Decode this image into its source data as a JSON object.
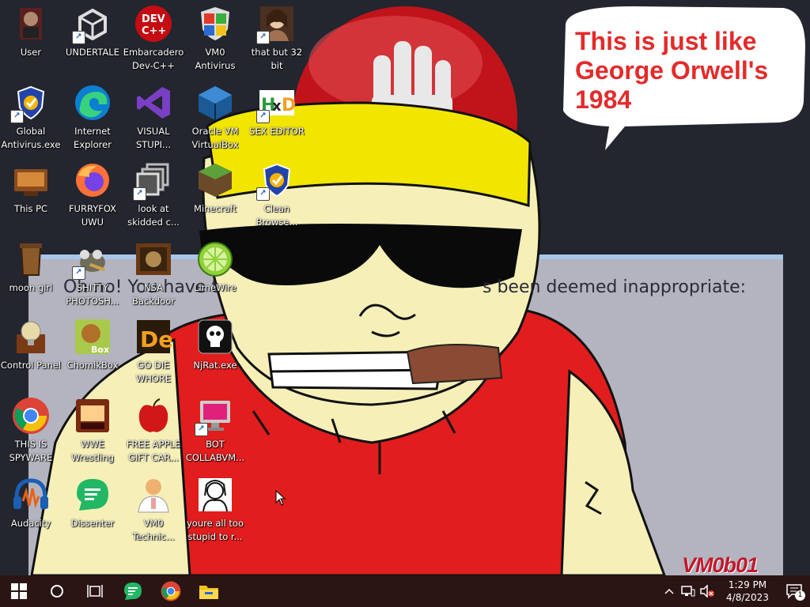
{
  "desktop": {
    "icons": [
      {
        "label": "User",
        "icon": "user-folder-icon"
      },
      {
        "label": "UNDERTALE",
        "icon": "unity-icon"
      },
      {
        "label": "Embarcadero Dev-C++",
        "icon": "devcpp-icon"
      },
      {
        "label": "VM0 Antivirus",
        "icon": "windows-shield-icon"
      },
      {
        "label": "that but 32 bit",
        "icon": "portrait-icon"
      },
      {
        "label": "Global Antivirus.exe",
        "icon": "shield-check-icon"
      },
      {
        "label": "Internet Explorer",
        "icon": "edge-icon"
      },
      {
        "label": "VISUAL STUPI...",
        "icon": "visual-studio-icon"
      },
      {
        "label": "Oracle VM VirtualBox",
        "icon": "virtualbox-icon"
      },
      {
        "label": "SEX EDITOR",
        "icon": "hxd-icon"
      },
      {
        "label": "This PC",
        "icon": "computer-icon"
      },
      {
        "label": "FURRYFOX UWU",
        "icon": "firefox-icon"
      },
      {
        "label": "look at skidded c...",
        "icon": "windows-stack-icon"
      },
      {
        "label": "Minecraft",
        "icon": "minecraft-icon"
      },
      {
        "label": "Clean Browse...",
        "icon": "shield-check-icon"
      },
      {
        "label": "moon girl",
        "icon": "bin-icon"
      },
      {
        "label": "SHITTY PHOTOSH...",
        "icon": "gimp-icon"
      },
      {
        "label": "NSA Backdoor",
        "icon": "picture-frame-icon"
      },
      {
        "label": "LimeWire",
        "icon": "limewire-icon"
      },
      {
        "label": "Control Panel",
        "icon": "lightbulb-icon"
      },
      {
        "label": "ChomikBox",
        "icon": "hamster-icon"
      },
      {
        "label": "GO DIE WHORE",
        "icon": "de-icon"
      },
      {
        "label": "NjRat.exe",
        "icon": "skull-icon"
      },
      {
        "label": "THIS IS SPYWARE",
        "icon": "chrome-icon"
      },
      {
        "label": "WWE Wrestling",
        "icon": "console-icon"
      },
      {
        "label": "FREE APPLE GIFT CAR...",
        "icon": "apple-icon"
      },
      {
        "label": "BOT COLLABVM...",
        "icon": "monitor-icon"
      },
      {
        "label": "Audacity",
        "icon": "audacity-icon"
      },
      {
        "label": "Dissenter",
        "icon": "chat-icon"
      },
      {
        "label": "VM0 Technic...",
        "icon": "doctor-icon"
      },
      {
        "label": "youre all too stupid to r...",
        "icon": "sketch-portrait-icon"
      }
    ]
  },
  "wallpaper": {
    "speech_bubble": "This is just like George Orwell's 1984",
    "background_text_left": "Oh no! You have t",
    "background_text_right": "s been deemed inappropriate:",
    "watermark": "VM0b01"
  },
  "taskbar": {
    "start": "start-icon",
    "search": "search-circle-icon",
    "task_view": "task-view-icon",
    "pinned": [
      "dissenter-icon",
      "chrome-icon",
      "file-explorer-icon"
    ],
    "tray": {
      "chevron": "^",
      "clock_time": "1:29 PM",
      "clock_date": "4/8/2023",
      "notification_count": "1"
    }
  },
  "colors": {
    "bubble_text": "#e32b2b",
    "taskbar_bg": "#2a1414",
    "watermark": "#c0192c"
  }
}
